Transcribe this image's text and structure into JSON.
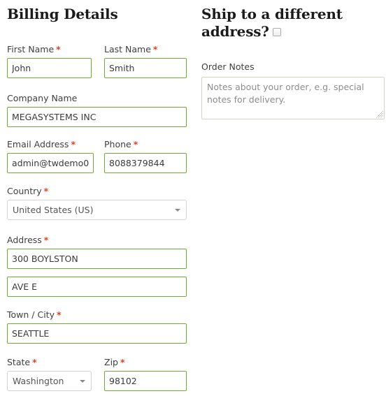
{
  "billing": {
    "heading": "Billing Details",
    "fields": {
      "first_name": {
        "label": "First Name",
        "required": "*",
        "value": "John"
      },
      "last_name": {
        "label": "Last Name",
        "required": "*",
        "value": "Smith"
      },
      "company_name": {
        "label": "Company Name",
        "value": "MEGASYSTEMS INC"
      },
      "email": {
        "label": "Email Address",
        "required": "*",
        "value": "admin@twdemo0"
      },
      "phone": {
        "label": "Phone",
        "required": "*",
        "value": "8088379844"
      },
      "country": {
        "label": "Country",
        "required": "*",
        "value": "United States (US)"
      },
      "address": {
        "label": "Address",
        "required": "*",
        "line1": "300 BOYLSTON",
        "line2": "AVE E"
      },
      "city": {
        "label": "Town / City",
        "required": "*",
        "value": "SEATTLE"
      },
      "state": {
        "label": "State",
        "required": "*",
        "value": "Washington"
      },
      "zip": {
        "label": "Zip",
        "required": "*",
        "value": "98102"
      }
    }
  },
  "shipping": {
    "heading": "Ship to a different address?",
    "checkbox_checked": "false"
  },
  "order_notes": {
    "label": "Order Notes",
    "placeholder": "Notes about your order, e.g. special notes for delivery.",
    "value": ""
  },
  "colors": {
    "valid_border": "#6cb032",
    "required_asterisk": "#e2401c",
    "select_border": "#d2d2d2",
    "textarea_border": "#d6d2c4",
    "text": "#3a3a3a",
    "placeholder": "#8c8c8c"
  }
}
